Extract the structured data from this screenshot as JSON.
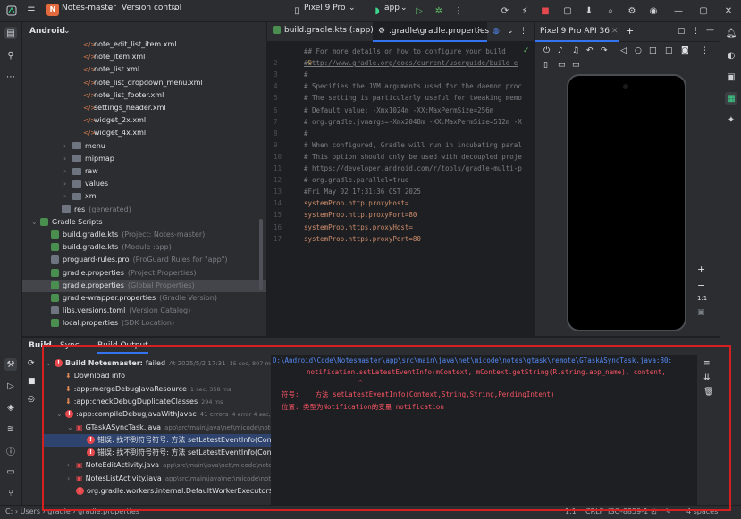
{
  "topbar": {
    "project_badge": "N",
    "project_name": "Notes-master",
    "vcs": "Version control",
    "device": "Pixel 9 Pro",
    "run_config": "app"
  },
  "project_panel": {
    "view": "Android",
    "rows": [
      {
        "label": "note_edit_list_item.xml",
        "note": "",
        "kind": "xml",
        "indent": 4,
        "caret": ""
      },
      {
        "label": "note_item.xml",
        "note": "",
        "kind": "xml",
        "indent": 4,
        "caret": ""
      },
      {
        "label": "note_list.xml",
        "note": "",
        "kind": "xml",
        "indent": 4,
        "caret": ""
      },
      {
        "label": "note_list_dropdown_menu.xml",
        "note": "",
        "kind": "xml",
        "indent": 4,
        "caret": ""
      },
      {
        "label": "note_list_footer.xml",
        "note": "",
        "kind": "xml",
        "indent": 4,
        "caret": ""
      },
      {
        "label": "settings_header.xml",
        "note": "",
        "kind": "xml",
        "indent": 4,
        "caret": ""
      },
      {
        "label": "widget_2x.xml",
        "note": "",
        "kind": "xml",
        "indent": 4,
        "caret": ""
      },
      {
        "label": "widget_4x.xml",
        "note": "",
        "kind": "xml",
        "indent": 4,
        "caret": ""
      },
      {
        "label": "menu",
        "note": "",
        "kind": "folder",
        "indent": 3,
        "caret": "›"
      },
      {
        "label": "mipmap",
        "note": "",
        "kind": "folder",
        "indent": 3,
        "caret": "›"
      },
      {
        "label": "raw",
        "note": "",
        "kind": "folder",
        "indent": 3,
        "caret": "›"
      },
      {
        "label": "values",
        "note": "",
        "kind": "folder",
        "indent": 3,
        "caret": "›"
      },
      {
        "label": "xml",
        "note": "",
        "kind": "folder",
        "indent": 3,
        "caret": "›"
      },
      {
        "label": "res",
        "note": "(generated)",
        "kind": "folder",
        "indent": 2,
        "caret": ""
      },
      {
        "label": "Gradle Scripts",
        "note": "",
        "kind": "gradle",
        "indent": 0,
        "caret": "⌄"
      },
      {
        "label": "build.gradle.kts",
        "note": "(Project: Notes-master)",
        "kind": "gradle",
        "indent": 1,
        "caret": ""
      },
      {
        "label": "build.gradle.kts",
        "note": "(Module :app)",
        "kind": "gradle",
        "indent": 1,
        "caret": ""
      },
      {
        "label": "proguard-rules.pro",
        "note": "(ProGuard Rules for \"app\")",
        "kind": "file",
        "indent": 1,
        "caret": ""
      },
      {
        "label": "gradle.properties",
        "note": "(Project Properties)",
        "kind": "gradle",
        "indent": 1,
        "caret": ""
      },
      {
        "label": "gradle.properties",
        "note": "(Global Properties)",
        "kind": "gradle",
        "indent": 1,
        "caret": "",
        "selected": true
      },
      {
        "label": "gradle-wrapper.properties",
        "note": "(Gradle Version)",
        "kind": "gradle",
        "indent": 1,
        "caret": ""
      },
      {
        "label": "libs.versions.toml",
        "note": "(Version Catalog)",
        "kind": "file",
        "indent": 1,
        "caret": ""
      },
      {
        "label": "local.properties",
        "note": "(SDK Location)",
        "kind": "gradle",
        "indent": 1,
        "caret": ""
      }
    ]
  },
  "editor": {
    "tabs": [
      {
        "label": "build.gradle.kts (:app)",
        "active": false
      },
      {
        "label": ".gradle\\gradle.properties",
        "active": true
      }
    ],
    "lines": [
      {
        "n": "",
        "text": "## For more details on how to configure your build",
        "color": "#7a7e85"
      },
      {
        "n": "2",
        "text": "#http://www.gradle.org/docs/current/userguide/build_e",
        "color": "#7a7e85",
        "underline": true
      },
      {
        "n": "3",
        "text": "#",
        "color": "#7a7e85"
      },
      {
        "n": "4",
        "text": "# Specifies the JVM arguments used for the daemon proc",
        "color": "#7a7e85"
      },
      {
        "n": "5",
        "text": "# The setting is particularly useful for tweaking memo",
        "color": "#7a7e85"
      },
      {
        "n": "6",
        "text": "# Default value: -Xmx1024m -XX:MaxPermSize=256m",
        "color": "#7a7e85"
      },
      {
        "n": "7",
        "text": "# org.gradle.jvmargs=-Xmx2048m -XX:MaxPermSize=512m -X",
        "color": "#7a7e85"
      },
      {
        "n": "8",
        "text": "#",
        "color": "#7a7e85"
      },
      {
        "n": "9",
        "text": "# When configured, Gradle will run in incubating paral",
        "color": "#7a7e85"
      },
      {
        "n": "10",
        "text": "# This option should only be used with decoupled proje",
        "color": "#7a7e85"
      },
      {
        "n": "11",
        "text": "# https://developer.android.com/r/tools/gradle-multi-p",
        "color": "#7a7e85",
        "underline": true
      },
      {
        "n": "12",
        "text": "# org.gradle.parallel=true",
        "color": "#7a7e85"
      },
      {
        "n": "13",
        "text": "#Fri May 02 17:31:36 CST 2025",
        "color": "#7a7e85"
      },
      {
        "n": "14",
        "text": "systemProp.http.proxyHost=",
        "color": "#cf8e6d"
      },
      {
        "n": "15",
        "text": "systemProp.http.proxyPort=80",
        "color": "#cf8e6d"
      },
      {
        "n": "16",
        "text": "systemProp.https.proxyHost=",
        "color": "#cf8e6d"
      },
      {
        "n": "17",
        "text": "systemProp.https.proxyPort=80",
        "color": "#cf8e6d"
      }
    ]
  },
  "emulator": {
    "title": "Pixel 9 Pro API 36",
    "zoom": "1:1"
  },
  "build_panel": {
    "tabs": [
      "Build",
      "Sync",
      "Build Output"
    ],
    "tree": [
      {
        "text": "Build Notesmaster:",
        "status": "failed",
        "meta": "At 2025/5/2 17:31",
        "time": "15 sec, 807 ms",
        "level": 0,
        "icon": "error",
        "caret": "⌄",
        "bold": true
      },
      {
        "text": "Download info",
        "status": "",
        "meta": "",
        "time": "",
        "level": 1,
        "icon": "task",
        "caret": ""
      },
      {
        "text": ":app:mergeDebugJavaResource",
        "status": "",
        "meta": "",
        "time": "1 sec, 358 ms",
        "level": 1,
        "icon": "task",
        "caret": ""
      },
      {
        "text": ":app:checkDebugDuplicateClasses",
        "status": "",
        "meta": "",
        "time": "294 ms",
        "level": 1,
        "icon": "task",
        "caret": ""
      },
      {
        "text": ":app:compileDebugJavaWithJavac",
        "status": "",
        "meta": "41 errors",
        "time": "4 error 4 sec, 309 ms",
        "level": 1,
        "icon": "error",
        "caret": "⌄"
      },
      {
        "text": "GTaskASyncTask.java",
        "status": "",
        "meta": "app\\src\\main\\java\\net\\micode\\note",
        "time": "",
        "level": 2,
        "icon": "file",
        "caret": "⌄"
      },
      {
        "text": "错误: 找不到符号符号:  方法 setLatestEventInfo(Context",
        "status": "",
        "meta": "",
        "time": "",
        "level": 3,
        "icon": "error",
        "caret": "",
        "selected": true
      },
      {
        "text": "错误: 找不到符号符号:  方法 setLatestEventInfo(Context",
        "status": "",
        "meta": "",
        "time": "",
        "level": 3,
        "icon": "error",
        "caret": ""
      },
      {
        "text": "NoteEditActivity.java",
        "status": "",
        "meta": "app\\src\\main\\java\\net\\micode\\note",
        "time": "",
        "level": 2,
        "icon": "file",
        "caret": "›"
      },
      {
        "text": "NotesListActivity.java",
        "status": "",
        "meta": "app\\src\\main\\java\\net\\micode\\note",
        "time": "",
        "level": 2,
        "icon": "file",
        "caret": "›"
      },
      {
        "text": "org.gradle.workers.internal.DefaultWorkerExecutor$Work",
        "status": "",
        "meta": "",
        "time": "",
        "level": 2,
        "icon": "error",
        "caret": ""
      }
    ],
    "output": {
      "path": "D:\\Android\\Code\\Notesmaster\\app\\src\\main\\java\\net\\micode\\notes\\gtask\\remote\\GTaskASyncTask.java:80:",
      "code_line": "notification.setLatestEventInfo(mContext, mContext.getString(R.string.app_name), content,",
      "caret": "^",
      "symbol_label": "符号:",
      "symbol_value": "方法 setLatestEventInfo(Context,String,String,PendingIntent)",
      "location_label": "位置:",
      "location_value": "类型为Notification的变量 notification"
    }
  },
  "statusbar": {
    "crumbs": [
      "C:",
      "Users",
      "gradle",
      "gradle.properties"
    ],
    "position": "1:1",
    "crlf": "CRLF",
    "encoding": "ISO-8859-1",
    "indent": "4 spaces"
  }
}
